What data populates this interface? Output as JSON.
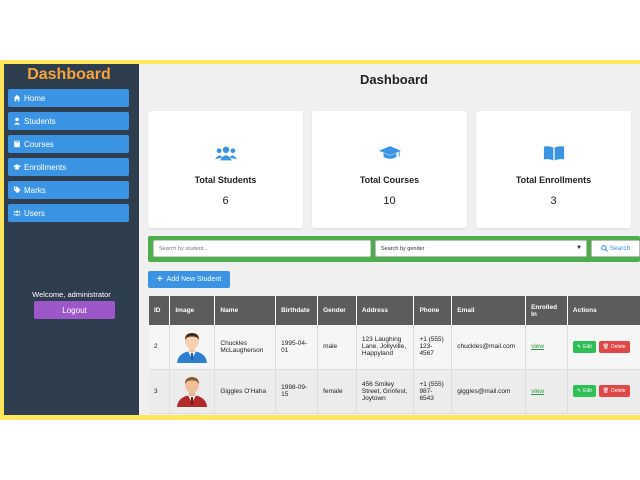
{
  "sidebar": {
    "title": "Dashboard",
    "items": [
      {
        "label": "Home",
        "icon": "home-icon"
      },
      {
        "label": "Students",
        "icon": "user-icon"
      },
      {
        "label": "Courses",
        "icon": "book-icon"
      },
      {
        "label": "Enrollments",
        "icon": "graduation-cap-icon"
      },
      {
        "label": "Marks",
        "icon": "tag-icon"
      },
      {
        "label": "Users",
        "icon": "users-icon"
      }
    ],
    "welcome": "Welcome, administrator",
    "logout_label": "Logout"
  },
  "main": {
    "title": "Dashboard",
    "cards": [
      {
        "label": "Total Students",
        "value": "6",
        "icon": "users-icon"
      },
      {
        "label": "Total Courses",
        "value": "10",
        "icon": "graduation-cap-icon"
      },
      {
        "label": "Total Enrollments",
        "value": "3",
        "icon": "open-book-icon"
      }
    ],
    "search": {
      "placeholder": "Search by student...",
      "gender_selected": "Search by gender",
      "button_label": "Search"
    },
    "add_button_label": "Add New Student",
    "table": {
      "headers": [
        "ID",
        "Image",
        "Name",
        "Birthdate",
        "Gender",
        "Address",
        "Phone",
        "Email",
        "Enrolled In",
        "Actions"
      ],
      "rows": [
        {
          "id": "2",
          "avatar": "male-avatar-blue-suit",
          "name": "Chuckles McLaugherson",
          "birthdate": "1995-04-01",
          "gender": "male",
          "address": "123 Laughing Lane, Jollyville, Happyland",
          "phone": "+1 (555) 123-4567",
          "email": "chuckles@mail.com",
          "enrolled": "view",
          "edit_label": "Edit",
          "delete_label": "Delete"
        },
        {
          "id": "3",
          "avatar": "male-avatar-red-suit",
          "name": "Giggles O'Haha",
          "birthdate": "1998-09-15",
          "gender": "female",
          "address": "456 Smiley Street, Grinfest, Joytown",
          "phone": "+1 (555) 987-6543",
          "email": "giggles@mail.com",
          "enrolled": "view",
          "edit_label": "Edit",
          "delete_label": "Delete"
        }
      ]
    }
  },
  "colors": {
    "frame": "#ffe45c",
    "sidebar_bg": "#2f3e4f",
    "sidebar_title": "#f7a43b",
    "nav_button": "#3a94e3",
    "logout": "#9c58c9",
    "card_icon": "#3a94e3",
    "search_bar": "#4cae4c",
    "table_header": "#5c5c5c",
    "edit": "#2fbf57",
    "delete": "#e04848"
  }
}
